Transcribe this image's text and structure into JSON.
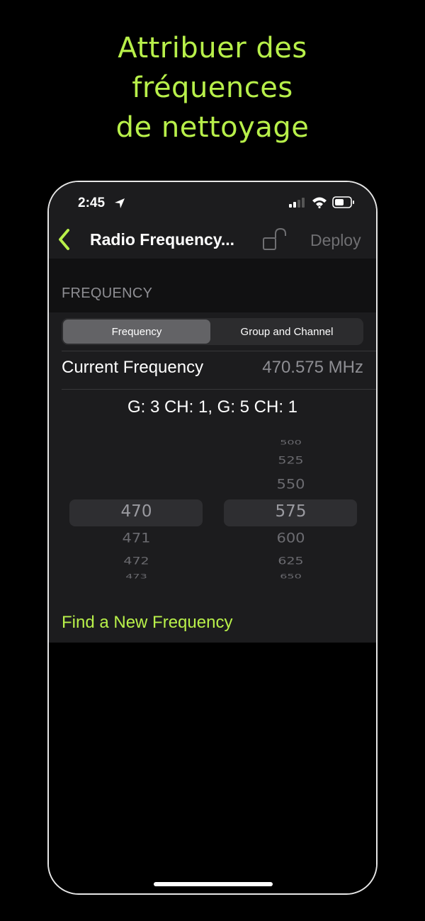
{
  "headline": [
    "Attribuer des",
    "fréquences",
    "de nettoyage"
  ],
  "status": {
    "time": "2:45"
  },
  "nav": {
    "title": "Radio Frequency...",
    "deploy": "Deploy"
  },
  "section": {
    "label": "FREQUENCY"
  },
  "segmented": {
    "active": "Frequency",
    "other": "Group and Channel"
  },
  "current": {
    "label": "Current Frequency",
    "value": "470.575 MHz"
  },
  "summary": "G: 3 CH: 1, G: 5 CH: 1",
  "picker_left": [
    "470",
    "471",
    "472",
    "473"
  ],
  "picker_right": [
    "500",
    "525",
    "550",
    "575",
    "600",
    "625",
    "650"
  ],
  "find_link": "Find a New Frequency",
  "colors": {
    "accent": "#b8f04a",
    "background": "#000000",
    "surface": "#1c1c1e"
  }
}
